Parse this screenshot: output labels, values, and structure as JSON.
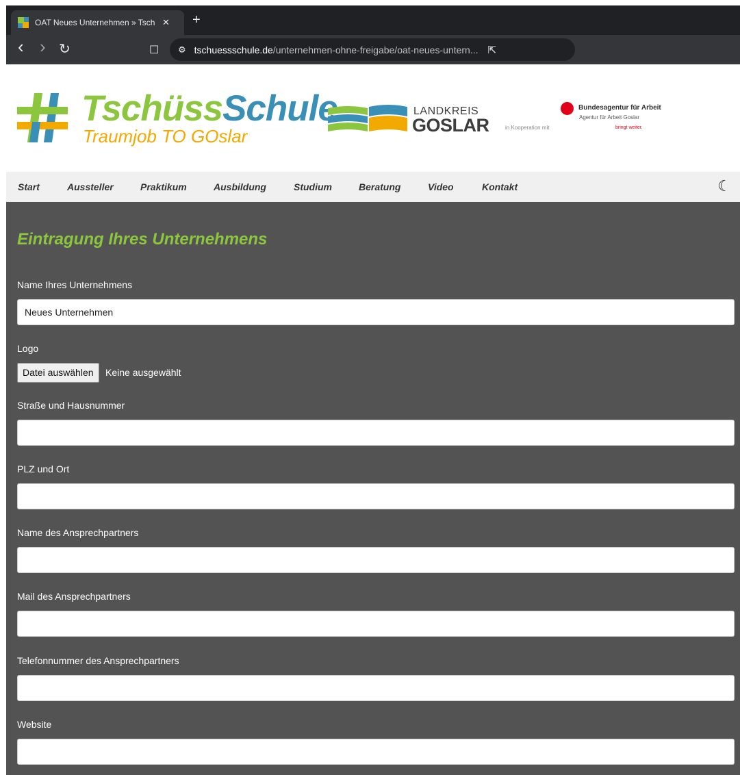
{
  "browser": {
    "tab_title": "OAT Neues Unternehmen » Tschü",
    "tab_close": "✕",
    "new_tab": "+",
    "back": "‹",
    "forward": "›",
    "reload": "↻",
    "bookmark": "☐",
    "site_settings": "⚙",
    "url_host": "tschuessschule.de",
    "url_path": "/unternehmen-ohne-freigabe/oat-neues-untern...",
    "share": "⇱"
  },
  "header": {
    "brand_part1": "Tschüss",
    "brand_part2": "Schule",
    "brand_subtitle": "Traumjob TO GOslar",
    "landkreis_line1": "LANDKREIS",
    "landkreis_line2": "GOSLAR",
    "cooperation_text": "in Kooperation mit",
    "ba_title": "Bundesagentur für Arbeit",
    "ba_sub": "Agentur für Arbeit Goslar",
    "ba_slogan": "bringt weiter."
  },
  "nav": {
    "items": [
      "Start",
      "Aussteller",
      "Praktikum",
      "Ausbildung",
      "Studium",
      "Beratung",
      "Video",
      "Kontakt"
    ],
    "dark_mode_icon": "☾"
  },
  "form": {
    "heading": "Eintragung Ihres Unternehmens",
    "company_name_label": "Name Ihres Unternehmens",
    "company_name_value": "Neues Unternehmen",
    "logo_label": "Logo",
    "file_button": "Datei auswählen",
    "file_status": "Keine ausgewählt",
    "street_label": "Straße und Hausnummer",
    "street_value": "",
    "zip_label": "PLZ und Ort",
    "zip_value": "",
    "contact_name_label": "Name des Ansprechpartners",
    "contact_name_value": "",
    "contact_mail_label": "Mail des Ansprechpartners",
    "contact_mail_value": "",
    "contact_phone_label": "Telefonnummer des Ansprechpartners",
    "contact_phone_value": "",
    "website_label": "Website",
    "website_value": ""
  },
  "colors": {
    "accent_green": "#8cc63f",
    "accent_blue": "#3a8fb7",
    "accent_orange": "#f2a900",
    "content_bg": "#535353",
    "ba_red": "#e2001a"
  }
}
